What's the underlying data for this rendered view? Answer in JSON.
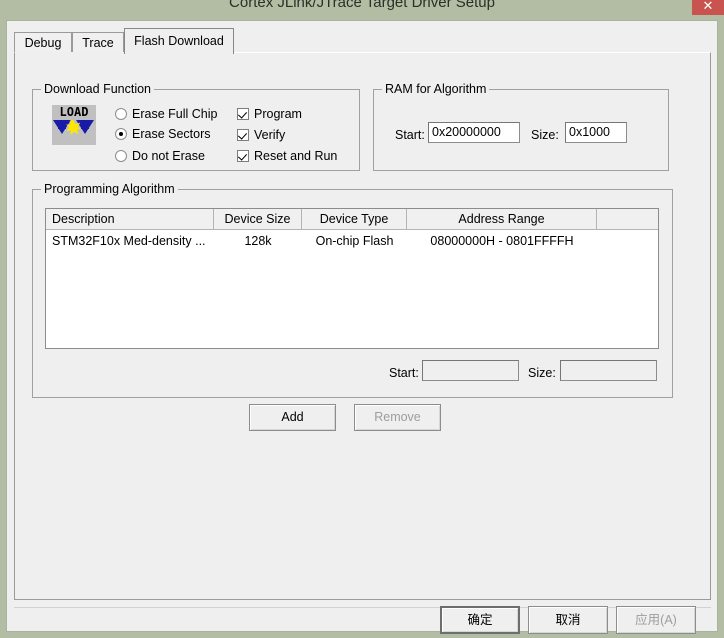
{
  "window": {
    "title": "Cortex JLink/JTrace Target Driver Setup",
    "close_label": "✕",
    "close_icon": "close-icon"
  },
  "tabs": [
    {
      "label": "Debug",
      "active": false
    },
    {
      "label": "Trace",
      "active": false
    },
    {
      "label": "Flash Download",
      "active": true
    }
  ],
  "download_function": {
    "legend": "Download Function",
    "icon": "load-icon",
    "icon_text": "LOAD",
    "radios": [
      {
        "label": "Erase Full Chip",
        "checked": false
      },
      {
        "label": "Erase Sectors",
        "checked": true
      },
      {
        "label": "Do not Erase",
        "checked": false
      }
    ],
    "checkboxes": [
      {
        "label": "Program",
        "checked": true
      },
      {
        "label": "Verify",
        "checked": true
      },
      {
        "label": "Reset and Run",
        "checked": true
      }
    ]
  },
  "ram_for_algorithm": {
    "legend": "RAM for Algorithm",
    "start_label": "Start:",
    "start_value": "0x20000000",
    "size_label": "Size:",
    "size_value": "0x1000"
  },
  "programming_algorithm": {
    "legend": "Programming Algorithm",
    "columns": [
      "Description",
      "Device Size",
      "Device Type",
      "Address Range",
      ""
    ],
    "rows": [
      {
        "description": "STM32F10x Med-density ...",
        "device_size": "128k",
        "device_type": "On-chip Flash",
        "address_range": "08000000H - 0801FFFFH",
        "extra": ""
      }
    ],
    "start_label": "Start:",
    "start_value": "",
    "size_label": "Size:",
    "size_value": ""
  },
  "algorithm_buttons": {
    "add_label": "Add",
    "remove_label": "Remove",
    "remove_enabled": false
  },
  "dialog_buttons": {
    "ok_label": "确定",
    "cancel_label": "取消",
    "apply_label": "应用(A)",
    "apply_enabled": false
  },
  "colors": {
    "titlebar": "#b2bda4",
    "dialog_face": "#efefef",
    "close_button": "#c9544f",
    "field_background": "#ffffff",
    "icon_arrow": "#1a1aa8",
    "icon_spark": "#ffe800"
  }
}
